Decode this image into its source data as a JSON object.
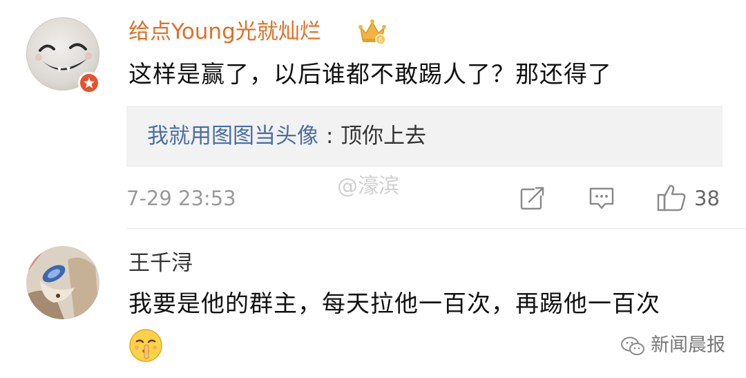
{
  "comments": [
    {
      "username": "给点Young光就灿烂",
      "text": "这样是赢了，以后谁都不敢踢人了？那还得了",
      "reply": {
        "author": "我就用图图当头像",
        "colon": ":",
        "text": "顶你上去"
      },
      "timestamp": "7-29 23:53",
      "likes": "38",
      "user_badge": "crown-icon",
      "avatar_badge": "verified-badge-icon",
      "username_color": "#e06f24"
    },
    {
      "username": "王千浔",
      "text": "我要是他的群主，每天拉他一百次，再踢他一百次",
      "emoji": "shush-emoji-icon"
    }
  ],
  "watermarks": {
    "center": "@濠滨",
    "footer": "新闻晨报"
  },
  "colors": {
    "reply_author": "#4a6ea3",
    "reply_background": "#f2f2f2",
    "badge": "#e8502e"
  },
  "icons": {
    "share": "share-icon",
    "comment": "comment-icon",
    "like": "thumbs-up-icon",
    "footer_logo": "wechat-icon"
  }
}
